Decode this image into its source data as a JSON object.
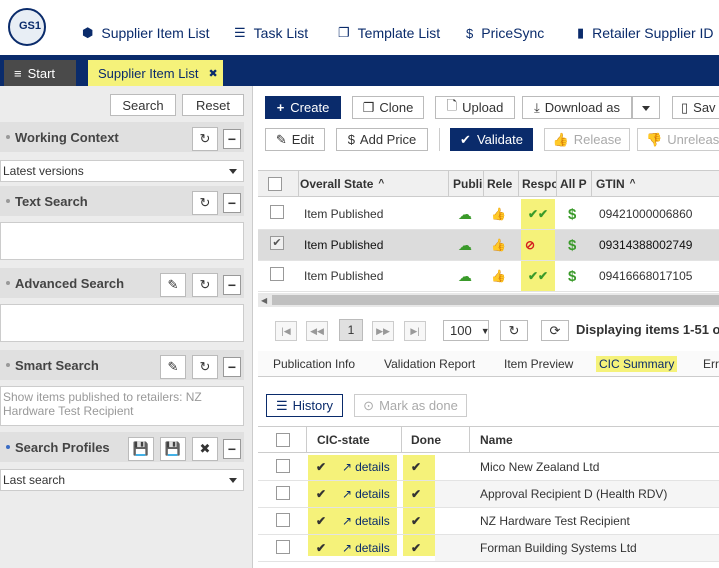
{
  "brand": {
    "logo_text": "GS1"
  },
  "topnav": [
    {
      "icon": "cube-icon",
      "glyph": "⬢",
      "label": "Supplier Item List"
    },
    {
      "icon": "list-icon",
      "glyph": "☰",
      "label": "Task List"
    },
    {
      "icon": "copy-icon",
      "glyph": "❐",
      "label": "Template List"
    },
    {
      "icon": "dollar-icon",
      "glyph": "$",
      "label": "PriceSync"
    },
    {
      "icon": "building-icon",
      "glyph": "▮",
      "label": "Retailer Supplier ID"
    }
  ],
  "tabs": {
    "start": "Start",
    "active": "Supplier Item List",
    "close": "✖",
    "menu_glyph": "≡"
  },
  "left": {
    "search_btn": "Search",
    "reset_btn": "Reset",
    "working_context": {
      "title": "Working Context",
      "value": "Latest versions"
    },
    "text_search": {
      "title": "Text Search",
      "value": ""
    },
    "advanced_search": {
      "title": "Advanced Search",
      "value": ""
    },
    "smart_search": {
      "title": "Smart Search",
      "placeholder": "Show items published to retailers: NZ Hardware Test Recipient"
    },
    "search_profiles": {
      "title": "Search Profiles",
      "value": "Last search"
    },
    "glyphs": {
      "refresh": "↻",
      "minus": "−",
      "edit": "✎",
      "save": "💾",
      "close": "✖"
    }
  },
  "toolbar": {
    "create": "Create",
    "clone": "Clone",
    "upload": "Upload",
    "download": "Download as",
    "save": "Sav",
    "edit": "Edit",
    "add_price": "Add Price",
    "validate": "Validate",
    "release": "Release",
    "unrelease": "Unrelease"
  },
  "grid": {
    "headers": {
      "state": "Overall State",
      "publ": "Publi",
      "rele": "Rele",
      "resp": "Respo",
      "allp": "All P",
      "gtin": "GTIN"
    },
    "rows": [
      {
        "state": "Item Published",
        "gtin": "09421000006860",
        "resp": "✔✔",
        "checked": false
      },
      {
        "state": "Item Published",
        "gtin": "09314388002749",
        "resp": "⊘",
        "checked": true
      },
      {
        "state": "Item Published",
        "gtin": "09416668017105",
        "resp": "✔✔",
        "checked": false
      }
    ],
    "glyphs": {
      "cloud": "☁",
      "thumb": "👍",
      "dollar": "$",
      "check": "✔",
      "sort": "^"
    }
  },
  "pagination": {
    "page": "1",
    "per_page": "100",
    "status": "Displaying items 1-51 o"
  },
  "subtabs": [
    "Publication Info",
    "Validation Report",
    "Item Preview",
    "CIC Summary",
    "Err"
  ],
  "cic": {
    "history": "History",
    "mark_done": "Mark as done",
    "headers": {
      "state": "CIC-state",
      "done": "Done",
      "name": "Name"
    },
    "details_label": "details",
    "rows": [
      {
        "name": "Mico New Zealand Ltd"
      },
      {
        "name": "Approval Recipient D (Health RDV)"
      },
      {
        "name": "NZ Hardware Test Recipient"
      },
      {
        "name": "Forman Building Systems Ltd"
      }
    ]
  },
  "colors": {
    "navy": "#0a2b6b",
    "highlight": "#f5f27a",
    "green": "#3a9a2a",
    "red": "#d42020"
  }
}
